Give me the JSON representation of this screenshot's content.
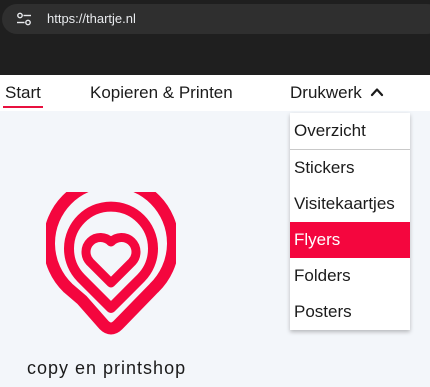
{
  "browser": {
    "url": "https://thartje.nl",
    "site_info_icon": "tune-icon"
  },
  "nav": {
    "items": [
      {
        "label": "Start",
        "active": true
      },
      {
        "label": "Kopieren & Printen"
      },
      {
        "label": "Drukwerk",
        "icon": "chevron-up-icon",
        "expanded": true
      }
    ]
  },
  "dropdown": {
    "items": [
      {
        "label": "Overzicht"
      },
      {
        "label": "Stickers"
      },
      {
        "label": "Visitekaartjes"
      },
      {
        "label": "Flyers",
        "highlighted": true
      },
      {
        "label": "Folders"
      },
      {
        "label": "Posters"
      }
    ]
  },
  "brand": {
    "tagline": "copy en printshop",
    "accent_color": "#f4063e",
    "logo_icon": "heart-location-pin-icon"
  }
}
